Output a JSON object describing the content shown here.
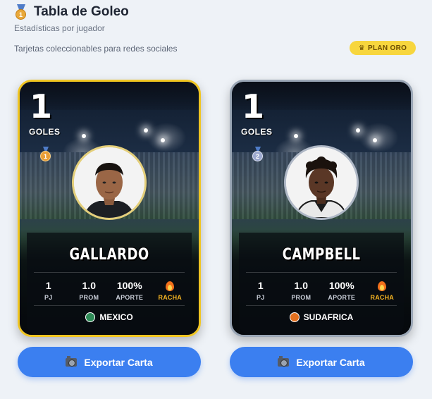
{
  "header": {
    "title": "Tabla de Goleo",
    "subtitle": "Estadísticas por jugador",
    "tagline": "Tarjetas coleccionables para redes sociales",
    "plan_badge": "PLAN ORO",
    "medal_number": "1"
  },
  "cards": [
    {
      "tier": "gold",
      "goals": "1",
      "goals_label": "GOLES",
      "rank": "1",
      "surname": "GALLARDO",
      "stats": [
        {
          "value": "1",
          "label": "PJ"
        },
        {
          "value": "1.0",
          "label": "PROM"
        },
        {
          "value": "100%",
          "label": "APORTE"
        },
        {
          "value": "",
          "label": "RACHA"
        }
      ],
      "country": "MEXICO",
      "country_color": "#2e8b57"
    },
    {
      "tier": "silver",
      "goals": "1",
      "goals_label": "GOLES",
      "rank": "2",
      "surname": "CAMPBELL",
      "stats": [
        {
          "value": "1",
          "label": "PJ"
        },
        {
          "value": "1.0",
          "label": "PROM"
        },
        {
          "value": "100%",
          "label": "APORTE"
        },
        {
          "value": "",
          "label": "RACHA"
        }
      ],
      "country": "SUDAFRICA",
      "country_color": "#e2701f"
    }
  ],
  "export_label": "Exportar Carta",
  "colors": {
    "accent": "#3b7ff0",
    "gold": "#f0c521",
    "silver": "#9aa6b5",
    "plan_badge": "#f7d63e"
  }
}
